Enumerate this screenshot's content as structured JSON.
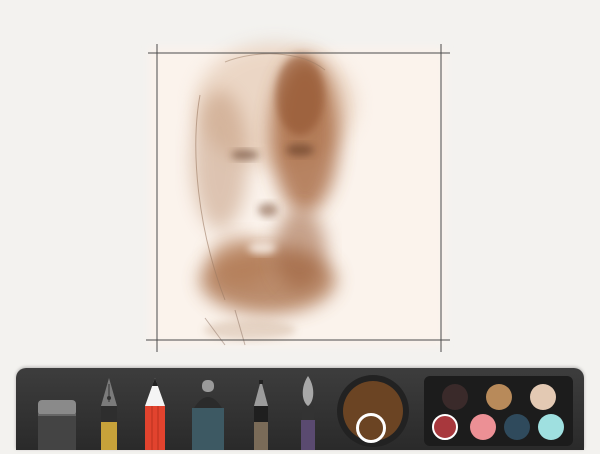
{
  "app": {
    "background_color": "#f3f2ef",
    "canvas": {
      "page_color": "#fbf3ec",
      "crop_marks": true
    }
  },
  "toolbar": {
    "tools": [
      {
        "name": "eraser",
        "icon": "eraser-icon"
      },
      {
        "name": "fountain-pen",
        "icon": "fountain-pen-icon",
        "color": "#c7a23a"
      },
      {
        "name": "pencil",
        "icon": "pencil-icon",
        "color": "#e2432e",
        "selected": true
      },
      {
        "name": "marker",
        "icon": "marker-icon",
        "color": "#3d5963"
      },
      {
        "name": "fineliner",
        "icon": "fineliner-icon",
        "color": "#7a6b58"
      },
      {
        "name": "watercolor-brush",
        "icon": "brush-icon",
        "color": "#5a4a70"
      }
    ],
    "current_color": "#6b4423",
    "palette": [
      {
        "color": "#3a2a2a",
        "selected": false
      },
      {
        "color": "#b88a5a",
        "selected": false
      },
      {
        "color": "#e3c9b3",
        "selected": false
      },
      {
        "color": "#a8383d",
        "selected": true
      },
      {
        "color": "#ec9095",
        "selected": false
      },
      {
        "color": "#2f4a5c",
        "selected": false
      },
      {
        "color": "#9fe0e0",
        "selected": false
      }
    ]
  }
}
